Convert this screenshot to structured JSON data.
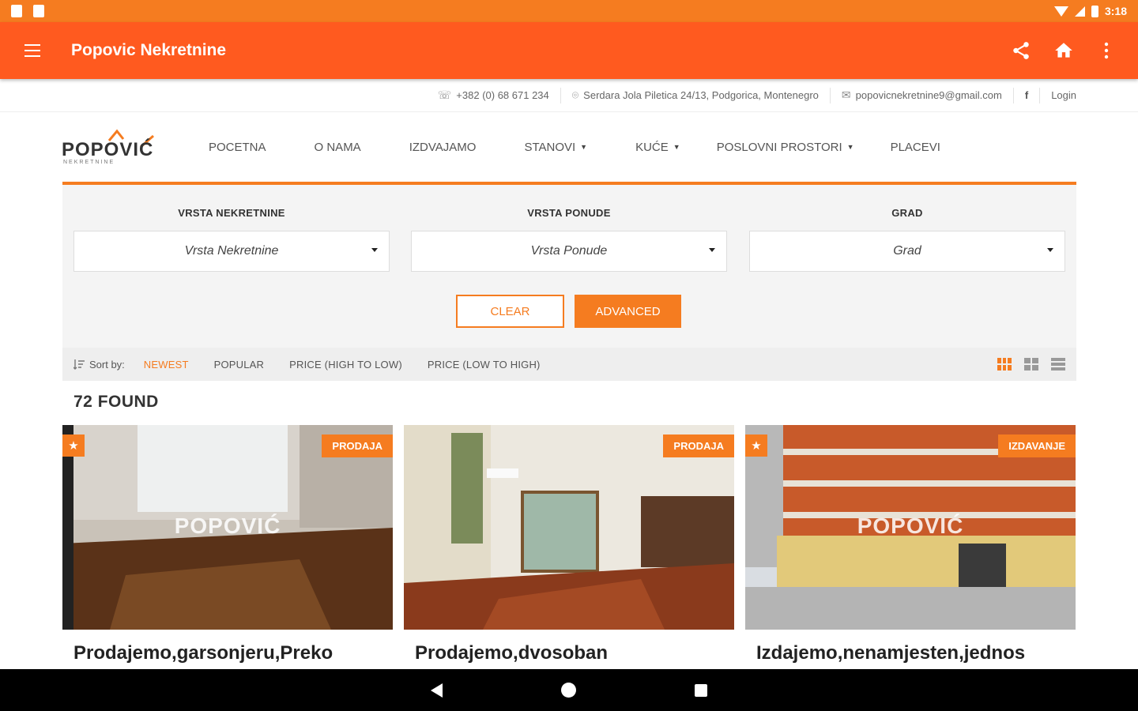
{
  "status_bar": {
    "time": "3:18"
  },
  "app_bar": {
    "title": "Popovic Nekretnine"
  },
  "contact": {
    "phone": "+382 (0) 68 671 234",
    "address": "Serdara Jola Piletica 24/13, Podgorica, Montenegro",
    "email": "popovicnekretnine9@gmail.com",
    "facebook": "f",
    "login": "Login"
  },
  "logo": {
    "text": "POPOVIĆ",
    "sub": "NEKRETNINE"
  },
  "nav": {
    "items": [
      "POCETNA",
      "O NAMA",
      "IZDVAJAMO",
      "STANOVI",
      "KUĆE",
      "POSLOVNI PROSTORI",
      "PLACEVI"
    ]
  },
  "search": {
    "fields": [
      {
        "label": "VRSTA NEKRETNINE",
        "value": "Vrsta Nekretnine"
      },
      {
        "label": "VRSTA PONUDE",
        "value": "Vrsta Ponude"
      },
      {
        "label": "GRAD",
        "value": "Grad"
      }
    ],
    "clear_label": "CLEAR",
    "advanced_label": "ADVANCED"
  },
  "sort": {
    "label": "Sort by:",
    "options": [
      "NEWEST",
      "POPULAR",
      "PRICE (HIGH TO LOW)",
      "PRICE (LOW TO HIGH)"
    ],
    "active": "NEWEST"
  },
  "results": {
    "count_text": "72 FOUND"
  },
  "listings": [
    {
      "badge": "PRODAJA",
      "title": "Prodajemo,garsonjeru,Preko",
      "featured": true
    },
    {
      "badge": "PRODAJA",
      "title": "Prodajemo,dvosoban",
      "featured": false
    },
    {
      "badge": "IZDAVANJE",
      "title": "Izdajemo,nenamjesten,jednos",
      "featured": true
    }
  ],
  "colors": {
    "accent": "#f57c20",
    "app_bar": "#ff5a1f",
    "status_bar": "#f57c20"
  }
}
